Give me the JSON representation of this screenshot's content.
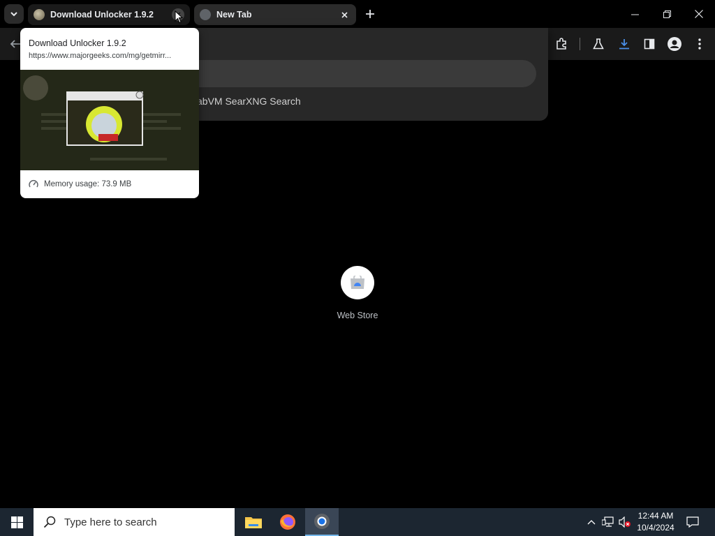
{
  "browser": {
    "tabs": [
      {
        "title": "Download Unlocker 1.9.2",
        "active": true
      },
      {
        "title": "New Tab",
        "active": false
      }
    ],
    "omnibox": {
      "suggestion": "abVM SearXNG Search"
    }
  },
  "hover_card": {
    "title": "Download Unlocker 1.9.2",
    "url": "https://www.majorgeeks.com/mg/getmirr...",
    "memory": "Memory usage: 73.9 MB"
  },
  "new_tab_page": {
    "shortcuts": [
      {
        "label": "Web Store"
      }
    ]
  },
  "taskbar": {
    "search_placeholder": "Type here to search",
    "apps": [
      "file-explorer",
      "firefox",
      "chrome"
    ],
    "clock": {
      "time": "12:44 AM",
      "date": "10/4/2024"
    }
  },
  "colors": {
    "tab_active": "#1a1a1a",
    "tab_inactive": "#2b2b2b",
    "download_accent": "#4a8fe8",
    "taskbar": "#1c2631"
  }
}
